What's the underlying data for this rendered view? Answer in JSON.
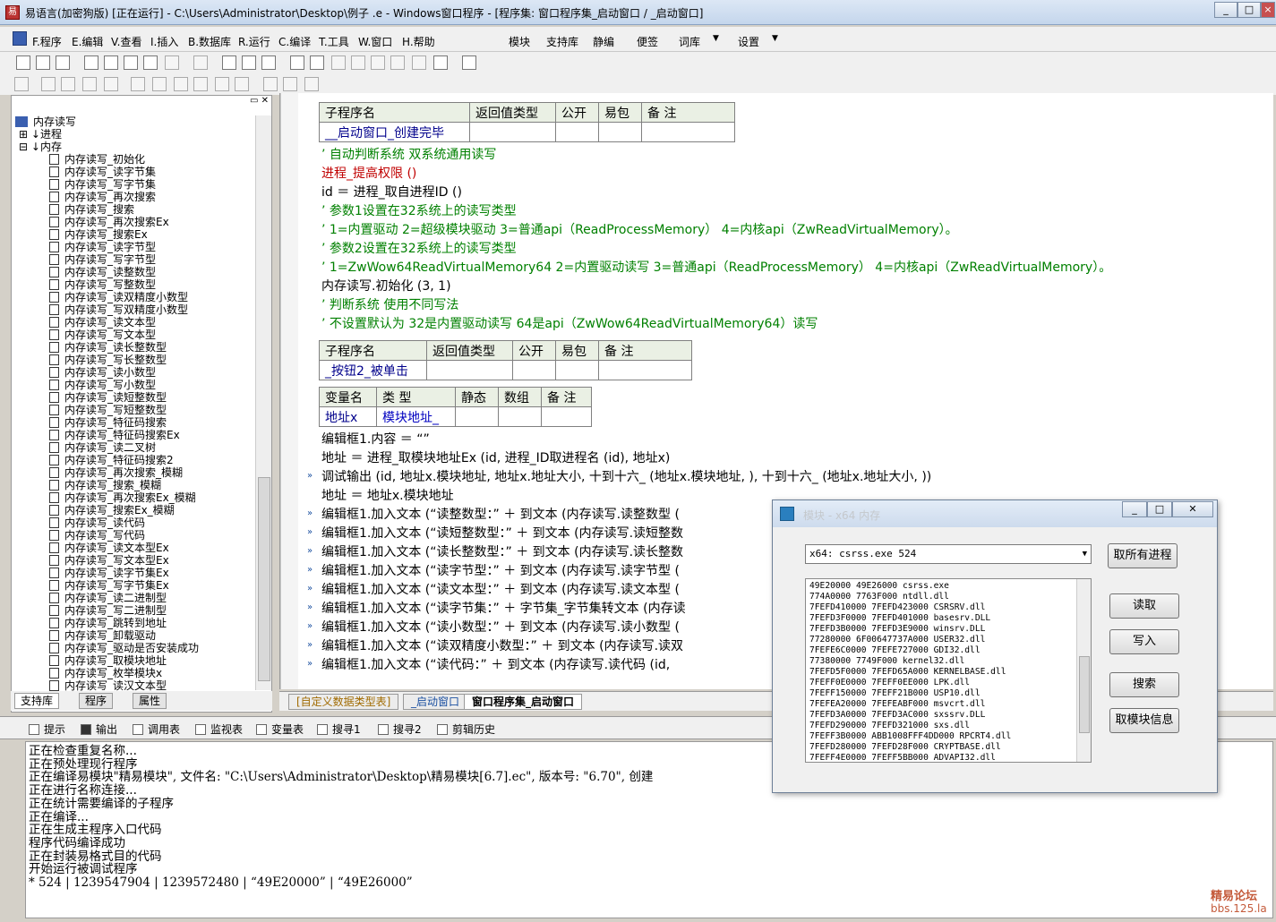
{
  "window": {
    "title": "易语言(加密狗版) [正在运行] - C:\\Users\\Administrator\\Desktop\\例子 .e - Windows窗口程序 - [程序集: 窗口程序集_启动窗口 / _启动窗口]",
    "min": "_",
    "max": "□",
    "close": "×"
  },
  "menu": {
    "items": [
      "F.程序",
      "E.编辑",
      "V.查看",
      "I.插入",
      "B.数据库",
      "R.运行",
      "C.编译",
      "T.工具",
      "W.窗口",
      "H.帮助"
    ],
    "right": [
      "模块",
      "支持库",
      "静编",
      "便签",
      "词库",
      "设置"
    ]
  },
  "tree": {
    "root": "内存读写",
    "n1": "进程",
    "n2": "内存",
    "items": [
      "内存读写_初始化",
      "内存读写_读字节集",
      "内存读写_写字节集",
      "内存读写_再次搜索",
      "内存读写_搜索",
      "内存读写_再次搜索Ex",
      "内存读写_搜索Ex",
      "内存读写_读字节型",
      "内存读写_写字节型",
      "内存读写_读整数型",
      "内存读写_写整数型",
      "内存读写_读双精度小数型",
      "内存读写_写双精度小数型",
      "内存读写_读文本型",
      "内存读写_写文本型",
      "内存读写_读长整数型",
      "内存读写_写长整数型",
      "内存读写_读小数型",
      "内存读写_写小数型",
      "内存读写_读短整数型",
      "内存读写_写短整数型",
      "内存读写_特征码搜索",
      "内存读写_特征码搜索Ex",
      "内存读写_读二叉树",
      "内存读写_特征码搜索2",
      "内存读写_再次搜索_模糊",
      "内存读写_搜索_模糊",
      "内存读写_再次搜索Ex_模糊",
      "内存读写_搜索Ex_模糊",
      "内存读写_读代码",
      "内存读写_写代码",
      "内存读写_读文本型Ex",
      "内存读写_写文本型Ex",
      "内存读写_读字节集Ex",
      "内存读写_写字节集Ex",
      "内存读写_读二进制型",
      "内存读写_写二进制型",
      "内存读写_跳转到地址",
      "内存读写_卸载驱动",
      "内存读写_驱动是否安装成功",
      "内存读写_取模块地址",
      "内存读写_枚举模块x",
      "内存读写_读汉文本型"
    ]
  },
  "lefttabs": [
    "支持库",
    "程序",
    "属性"
  ],
  "table1": {
    "h": [
      "子程序名",
      "返回值类型",
      "公开",
      "易包",
      "备 注"
    ],
    "r": [
      "__启动窗口_创建完毕",
      "",
      "",
      "",
      ""
    ]
  },
  "code1": [
    {
      "t": "’ 自动判断系统 双系统通用读写",
      "c": "g"
    },
    {
      "t": "进程_提高权限 ()",
      "c": "r"
    },
    {
      "t": "id ＝ 进程_取自进程ID ()",
      "c": "m1"
    },
    {
      "t": "’ 参数1设置在32系统上的读写类型",
      "c": "g"
    },
    {
      "t": "’ 1=内置驱动 2=超级模块驱动 3=普通api（ReadProcessMemory） 4=内核api（ZwReadVirtualMemory）。",
      "c": "g"
    },
    {
      "t": "’ 参数2设置在32系统上的读写类型",
      "c": "g"
    },
    {
      "t": "’ 1=ZwWow64ReadVirtualMemory64 2=内置驱动读写 3=普通api（ReadProcessMemory） 4=内核api（ZwReadVirtualMemory）。",
      "c": "g"
    },
    {
      "t": "内存读写.初始化 (3, 1)",
      "c": "m2"
    },
    {
      "t": "’ 判断系统 使用不同写法",
      "c": "g"
    },
    {
      "t": "’ 不设置默认为 32是内置驱动读写 64是api（ZwWow64ReadVirtualMemory64）读写",
      "c": "g"
    }
  ],
  "table2": {
    "h": [
      "子程序名",
      "返回值类型",
      "公开",
      "易包",
      "备 注"
    ],
    "r": [
      "_按钮2_被单击",
      "",
      "",
      "",
      ""
    ]
  },
  "table3": {
    "h": [
      "变量名",
      "类 型",
      "静态",
      "数组",
      "备 注"
    ],
    "r": [
      "地址x",
      "模块地址_",
      "",
      "",
      ""
    ]
  },
  "code2": [
    "编辑框1.内容 ＝ “”",
    "地址 ＝ 进程_取模块地址Ex (id, 进程_ID取进程名 (id), 地址x)",
    "调试输出 (id, 地址x.模块地址, 地址x.地址大小, 十到十六_ (地址x.模块地址, ), 十到十六_ (地址x.地址大小, ))",
    "地址 ＝ 地址x.模块地址",
    "编辑框1.加入文本 (“读整数型：” ＋ 到文本 (内存读写.读整数型 (",
    "编辑框1.加入文本 (“读短整数型：” ＋ 到文本 (内存读写.读短整数",
    "编辑框1.加入文本 (“读长整数型：” ＋ 到文本 (内存读写.读长整数",
    "编辑框1.加入文本 (“读字节型：” ＋ 到文本 (内存读写.读字节型 (",
    "编辑框1.加入文本 (“读文本型：” ＋ 到文本 (内存读写.读文本型 (",
    "编辑框1.加入文本 (“读字节集：” ＋ 字节集_字节集转文本 (内存读",
    "编辑框1.加入文本 (“读小数型：” ＋ 到文本 (内存读写.读小数型 (",
    "编辑框1.加入文本 (“读双精度小数型：” ＋ 到文本 (内存读写.读双",
    "编辑框1.加入文本 (“读代码：” ＋ 到文本 (内存读写.读代码 (id,"
  ],
  "edtabs": [
    "[自定义数据类型表]",
    "_启动窗口",
    "窗口程序集_启动窗口"
  ],
  "outtabs": [
    "提示",
    "输出",
    "调用表",
    "监视表",
    "变量表",
    "搜寻1",
    "搜寻2",
    "剪辑历史"
  ],
  "output": [
    "正在检查重复名称...",
    "正在预处理现行程序",
    "正在编译易模块\"精易模块\", 文件名: \"C:\\Users\\Administrator\\Desktop\\精易模块[6.7].ec\", 版本号: \"6.70\", 创建",
    "正在进行名称连接...",
    "正在统计需要编译的子程序",
    "正在编译...",
    "正在生成主程序入口代码",
    "程序代码编译成功",
    "正在封装易格式目的代码",
    "开始运行被调试程序",
    "* 524 | 1239547904 | 1239572480 | “49E20000” | “49E26000”"
  ],
  "dialog": {
    "title": "模块 - x64 内存",
    "combo": "x64: csrss.exe    524",
    "btn_all": "取所有进程",
    "btn_read": "读取",
    "btn_write": "写入",
    "btn_search": "搜索",
    "btn_mod": "取模块信息",
    "modules": [
      "49E20000 49E26000 csrss.exe",
      "774A0000 7763F000 ntdll.dll",
      "7FEFD410000 7FEFD423000 CSRSRV.dll",
      "7FEFD3F0000 7FEFD401000 basesrv.DLL",
      "7FEFD3B0000 7FEFD3E9000 winsrv.DLL",
      "77280000 6F00647737A000 USER32.dll",
      "7FEFE6C0000 7FEFE727000 GDI32.dll",
      "77380000 7749F000 kernel32.dll",
      "7FEFD5F0000 7FEFD65A000 KERNELBASE.dll",
      "7FEFF0E0000 7FEFF0EE000 LPK.dll",
      "7FEFF150000 7FEFF21B000 USP10.dll",
      "7FEFEA20000 7FEFEABF000 msvcrt.dll",
      "7FEFD3A0000 7FEFD3AC000 sxssrv.DLL",
      "7FEFD290000 7FEFD321000 sxs.dll",
      "7FEFF3B0000 ABB1008FFF4DD000 RPCRT4.dll",
      "7FEFD280000 7FEFD28F000 CRYPTBASE.dll",
      "7FEFF4E0000 7FEFF5BB000 ADVAPI32.dll"
    ]
  },
  "watermark": {
    "l1": "精易论坛",
    "l2": "bbs.125.la"
  }
}
